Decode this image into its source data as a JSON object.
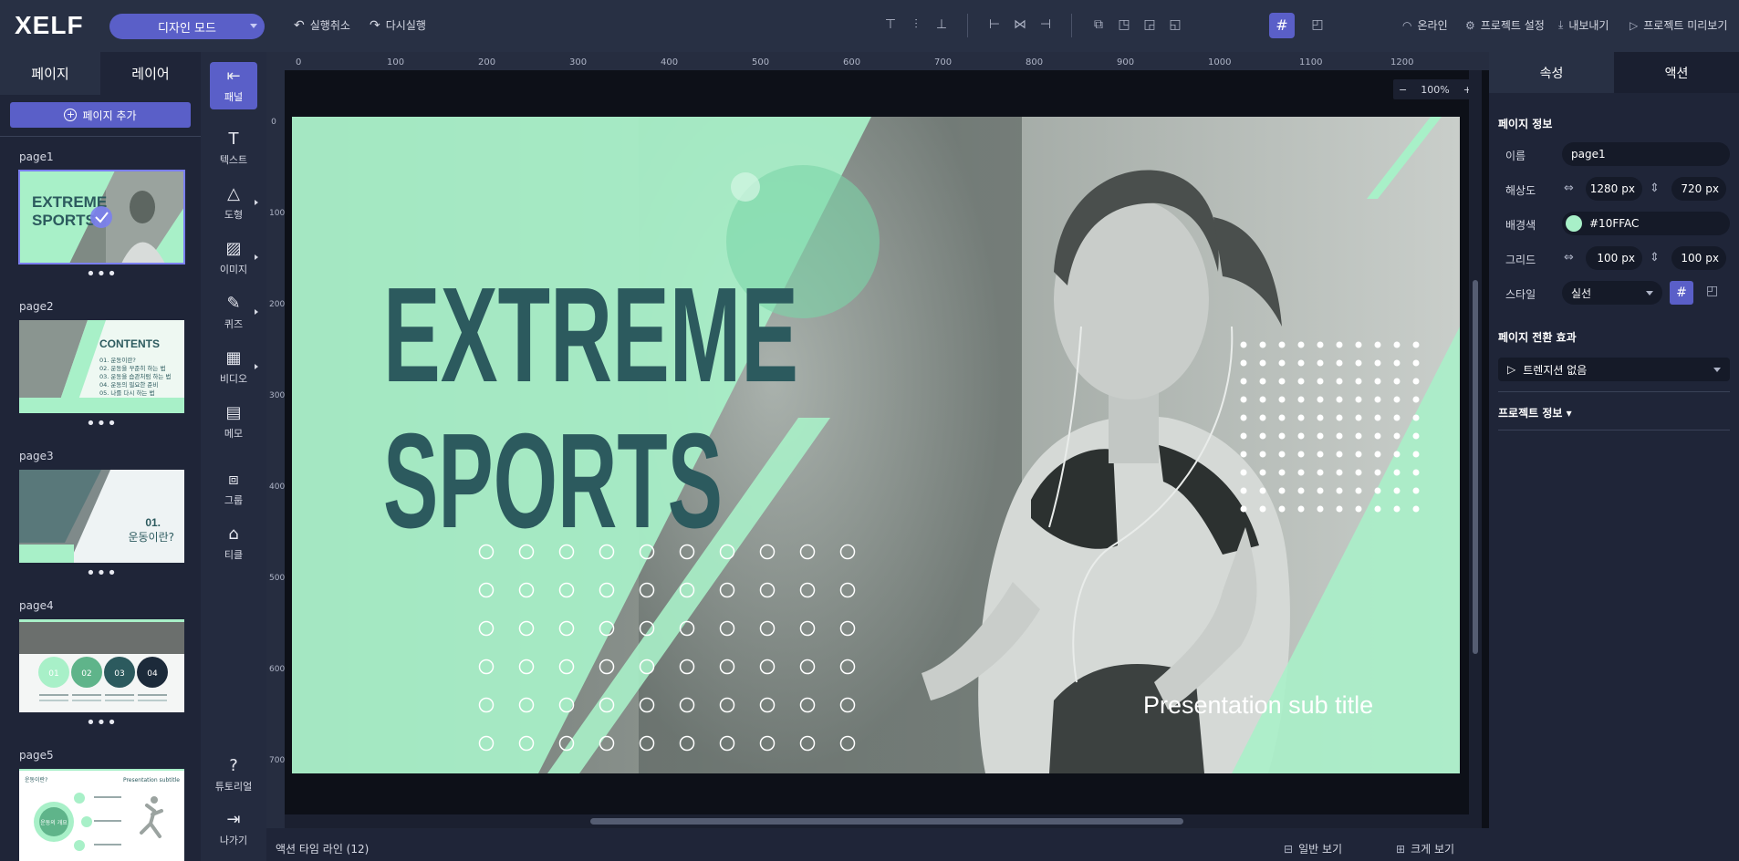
{
  "app": {
    "logo": "XELF",
    "mode": "디자인 모드",
    "undo": "실행취소",
    "redo": "다시실행",
    "online": "온라인",
    "project_settings": "프로젝트 설정",
    "export": "내보내기",
    "preview": "프로젝트 미리보기"
  },
  "left_panel": {
    "tabs": [
      "페이지",
      "레이어"
    ],
    "add_page": "페이지 추가",
    "more": "•••",
    "pages": [
      {
        "label": "page1",
        "title": [
          "EXTREME",
          "SPORTS"
        ]
      },
      {
        "label": "page2",
        "title": "CONTENTS",
        "items": [
          "01. 운동이란?",
          "02. 운동을 꾸준히 하는 법",
          "03. 운동을 습관처럼 하는 법",
          "04. 운동의 필요한 준비",
          "05. 나를 다시 하는 법"
        ]
      },
      {
        "label": "page3",
        "title": [
          "01.",
          "운동이란?"
        ]
      },
      {
        "label": "page4",
        "circles": [
          "01",
          "02",
          "03",
          "04"
        ]
      },
      {
        "label": "page5",
        "title": "운동이란?",
        "subtitle": "Presentation subtitle",
        "center": "운동의 개요"
      }
    ]
  },
  "tools": [
    {
      "label": "패널",
      "icon": "panel-icon"
    },
    {
      "label": "텍스트",
      "icon": "text-icon"
    },
    {
      "label": "도형",
      "icon": "shape-icon"
    },
    {
      "label": "이미지",
      "icon": "image-icon"
    },
    {
      "label": "퀴즈",
      "icon": "quiz-icon"
    },
    {
      "label": "비디오",
      "icon": "video-icon"
    },
    {
      "label": "메모",
      "icon": "memo-icon"
    },
    {
      "label": "그룹",
      "icon": "group-icon"
    },
    {
      "label": "티클",
      "icon": "tickle-icon"
    },
    {
      "label": "튜토리얼",
      "icon": "tutorial-icon"
    },
    {
      "label": "나가기",
      "icon": "exit-icon"
    }
  ],
  "canvas": {
    "zoom": "100%",
    "ruler_top": [
      "0",
      "100",
      "200",
      "300",
      "400",
      "500",
      "600",
      "700",
      "800",
      "900",
      "1000",
      "1100",
      "1200"
    ],
    "ruler_left": [
      "0",
      "100",
      "200",
      "300",
      "400",
      "500",
      "600",
      "700"
    ],
    "slide": {
      "title_line1": "EXTREME",
      "title_line2": "SPORTS",
      "subtitle": "Presentation sub title",
      "bg_color": "#A8F0C8",
      "text_color": "#2C5A5E"
    }
  },
  "bottom": {
    "timeline": "액션 타임 라인 (12)",
    "normal_view": "일반 보기",
    "large_view": "크게 보기"
  },
  "right_panel": {
    "tabs": [
      "속성",
      "액션"
    ],
    "page_info": "페이지 정보",
    "name_label": "이름",
    "name_value": "page1",
    "resolution_label": "해상도",
    "width": "1280",
    "height": "720",
    "unit": "px",
    "bg_label": "배경색",
    "bg_value": "#10FFAC",
    "grid_label": "그리드",
    "grid_x": "100",
    "grid_y": "100",
    "style_label": "스타일",
    "style_value": "실선",
    "transition_section": "페이지 전환 효과",
    "transition_value": "트렌지션 없음",
    "project_info": "프로젝트 정보 ▾"
  }
}
